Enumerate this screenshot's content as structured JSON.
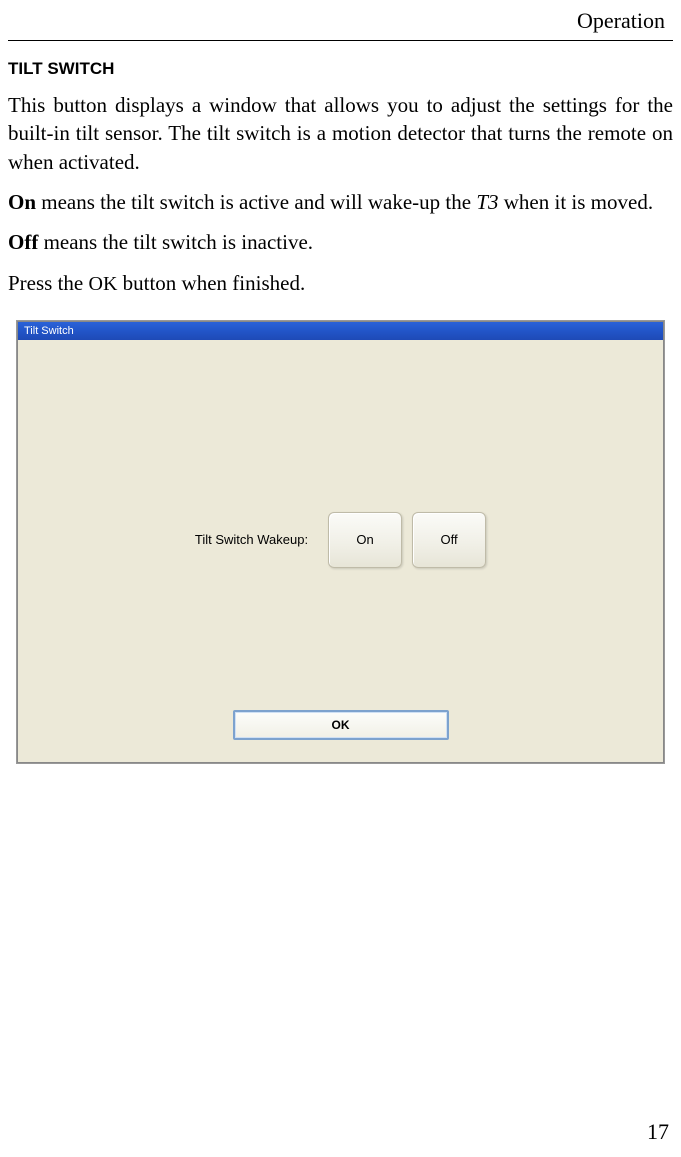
{
  "header": {
    "section": "Operation"
  },
  "section": {
    "heading": "TILT SWITCH",
    "para1": "This button displays a window that allows you to adjust the settings for the built-in tilt sensor. The tilt switch is a motion detector that turns the remote on when activated.",
    "para2_prefix": "On",
    "para2_rest": " means the tilt switch is active and will wake-up the ",
    "para2_italic": "T3",
    "para2_after": " when it is moved.",
    "para3_prefix": "Off",
    "para3_rest": " means the tilt switch is inactive.",
    "para4_prefix": "Press the ",
    "para4_button": "OK",
    "para4_rest": " button when finished."
  },
  "dialog": {
    "title": "Tilt Switch",
    "label": "Tilt Switch Wakeup:",
    "on_label": "On",
    "off_label": "Off",
    "ok_label": "OK"
  },
  "page": {
    "number": "17"
  }
}
